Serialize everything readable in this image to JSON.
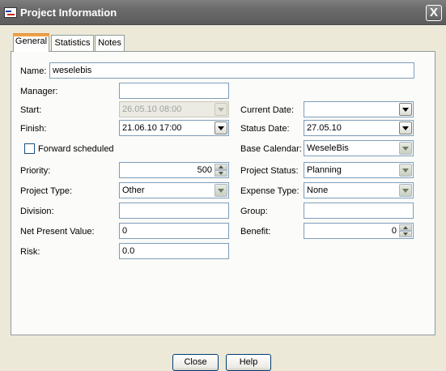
{
  "window": {
    "title": "Project Information",
    "close_glyph": "X"
  },
  "tabs": [
    {
      "label": "General",
      "active": true
    },
    {
      "label": "Statistics",
      "active": false
    },
    {
      "label": "Notes",
      "active": false
    }
  ],
  "form": {
    "name": {
      "label": "Name:",
      "value": "weselebis"
    },
    "manager": {
      "label": "Manager:",
      "value": ""
    },
    "start": {
      "label": "Start:",
      "value": "26.05.10 08:00",
      "enabled": false
    },
    "finish": {
      "label": "Finish:",
      "value": "21.06.10 17:00"
    },
    "forward_scheduled": {
      "label": "Forward scheduled",
      "checked": false
    },
    "priority": {
      "label": "Priority:",
      "value": "500"
    },
    "project_type": {
      "label": "Project Type:",
      "value": "Other"
    },
    "division": {
      "label": "Division:",
      "value": ""
    },
    "net_present_value": {
      "label": "Net Present Value:",
      "value": "0"
    },
    "risk": {
      "label": "Risk:",
      "value": "0.0"
    },
    "current_date": {
      "label": "Current Date:",
      "value": ""
    },
    "status_date": {
      "label": "Status Date:",
      "value": "27.05.10"
    },
    "base_calendar": {
      "label": "Base Calendar:",
      "value": "WeseleBis"
    },
    "project_status": {
      "label": "Project Status:",
      "value": "Planning"
    },
    "expense_type": {
      "label": "Expense Type:",
      "value": "None"
    },
    "group": {
      "label": "Group:",
      "value": ""
    },
    "benefit": {
      "label": "Benefit:",
      "value": "0"
    }
  },
  "buttons": {
    "close_label": "Close",
    "help_label": "Help"
  },
  "colors": {
    "titlebar": "#6a6a6a",
    "dialog_bg": "#ece9d8",
    "field_border": "#7f9db9",
    "active_tab_accent": "#f0a04a"
  }
}
